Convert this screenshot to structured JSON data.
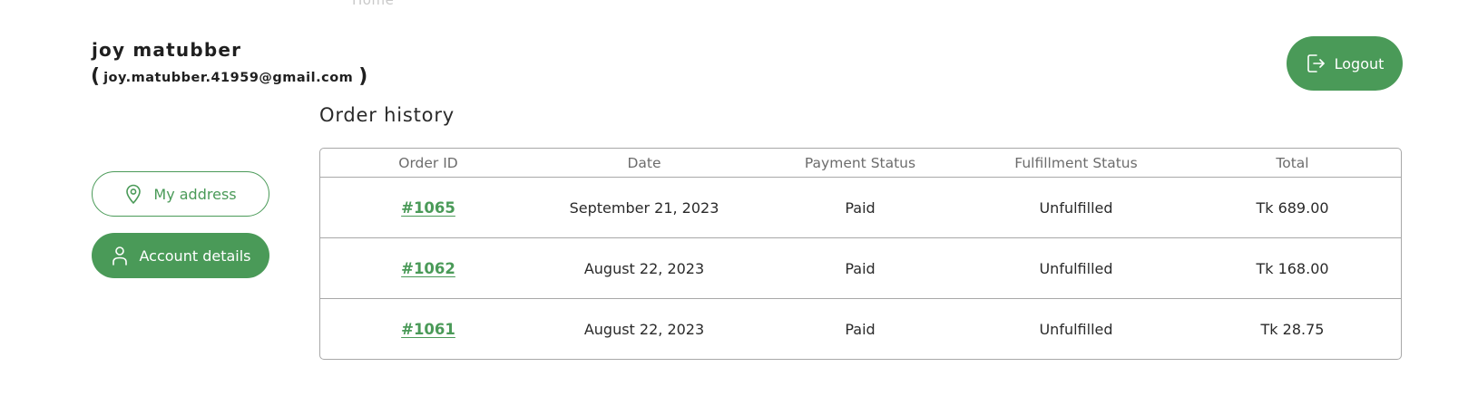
{
  "top_clipped_text": "Home",
  "user": {
    "name": "joy matubber",
    "paren_open": "(",
    "email": "joy.matubber.41959@gmail.com",
    "paren_close": ")"
  },
  "header": {
    "logout_label": "Logout",
    "logout_icon": "logout-icon"
  },
  "sidebar": {
    "items": [
      {
        "label": "My address",
        "icon": "location-pin-icon",
        "active": false
      },
      {
        "label": "Account details",
        "icon": "user-icon",
        "active": true
      }
    ]
  },
  "colors": {
    "accent": "#4a9a58",
    "border": "#a8a8a8",
    "header_text": "#6c6c6c"
  },
  "order_history": {
    "title": "Order history",
    "columns": [
      "Order ID",
      "Date",
      "Payment Status",
      "Fulfillment Status",
      "Total"
    ],
    "rows": [
      {
        "order_id": "#1065",
        "date": "September 21, 2023",
        "payment_status": "Paid",
        "fulfillment_status": "Unfulfilled",
        "total": "Tk 689.00"
      },
      {
        "order_id": "#1062",
        "date": "August 22, 2023",
        "payment_status": "Paid",
        "fulfillment_status": "Unfulfilled",
        "total": "Tk 168.00"
      },
      {
        "order_id": "#1061",
        "date": "August 22, 2023",
        "payment_status": "Paid",
        "fulfillment_status": "Unfulfilled",
        "total": "Tk 28.75"
      }
    ]
  }
}
